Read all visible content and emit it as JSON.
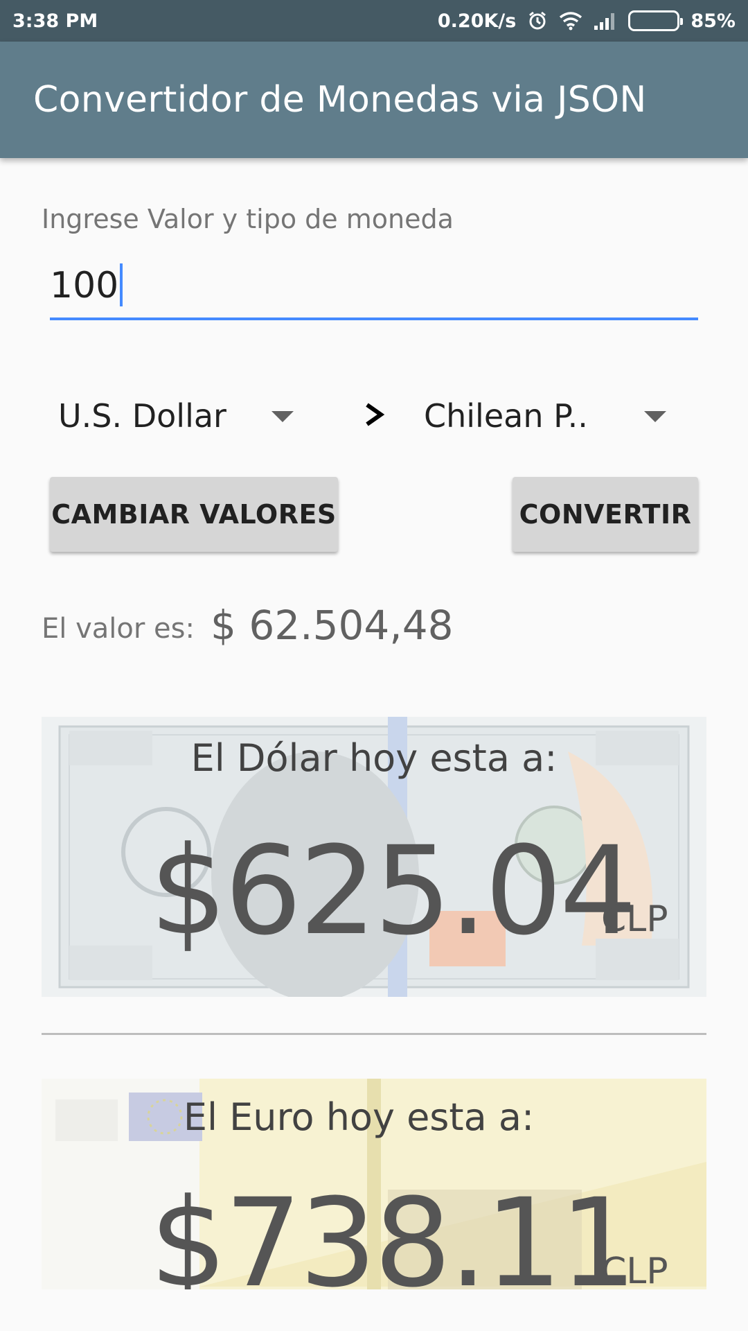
{
  "status_bar": {
    "time": "3:38 PM",
    "network_speed": "0.20K/s",
    "battery": "85%",
    "icons": [
      "alarm-icon",
      "wifi-icon",
      "signal-icon",
      "battery-icon"
    ]
  },
  "app_bar": {
    "title": "Convertidor de Monedas via JSON",
    "color": "#607d8b"
  },
  "form": {
    "input_label": "Ingrese Valor y tipo de moneda",
    "input_value": "100",
    "from_currency": "U.S. Dollar",
    "to_currency": "Chilean P..",
    "swap_button": "CAMBIAR VALORES",
    "convert_button": "CONVERTIR",
    "accent_color": "#448aff"
  },
  "result": {
    "label": "El valor es:",
    "value": "$ 62.504,48"
  },
  "rates": {
    "dollar": {
      "caption": "El Dólar hoy esta a:",
      "value": "$625.04",
      "code": "CLP"
    },
    "euro": {
      "caption": "El Euro hoy esta a:",
      "value": "$738.11",
      "code": "CLP"
    }
  }
}
